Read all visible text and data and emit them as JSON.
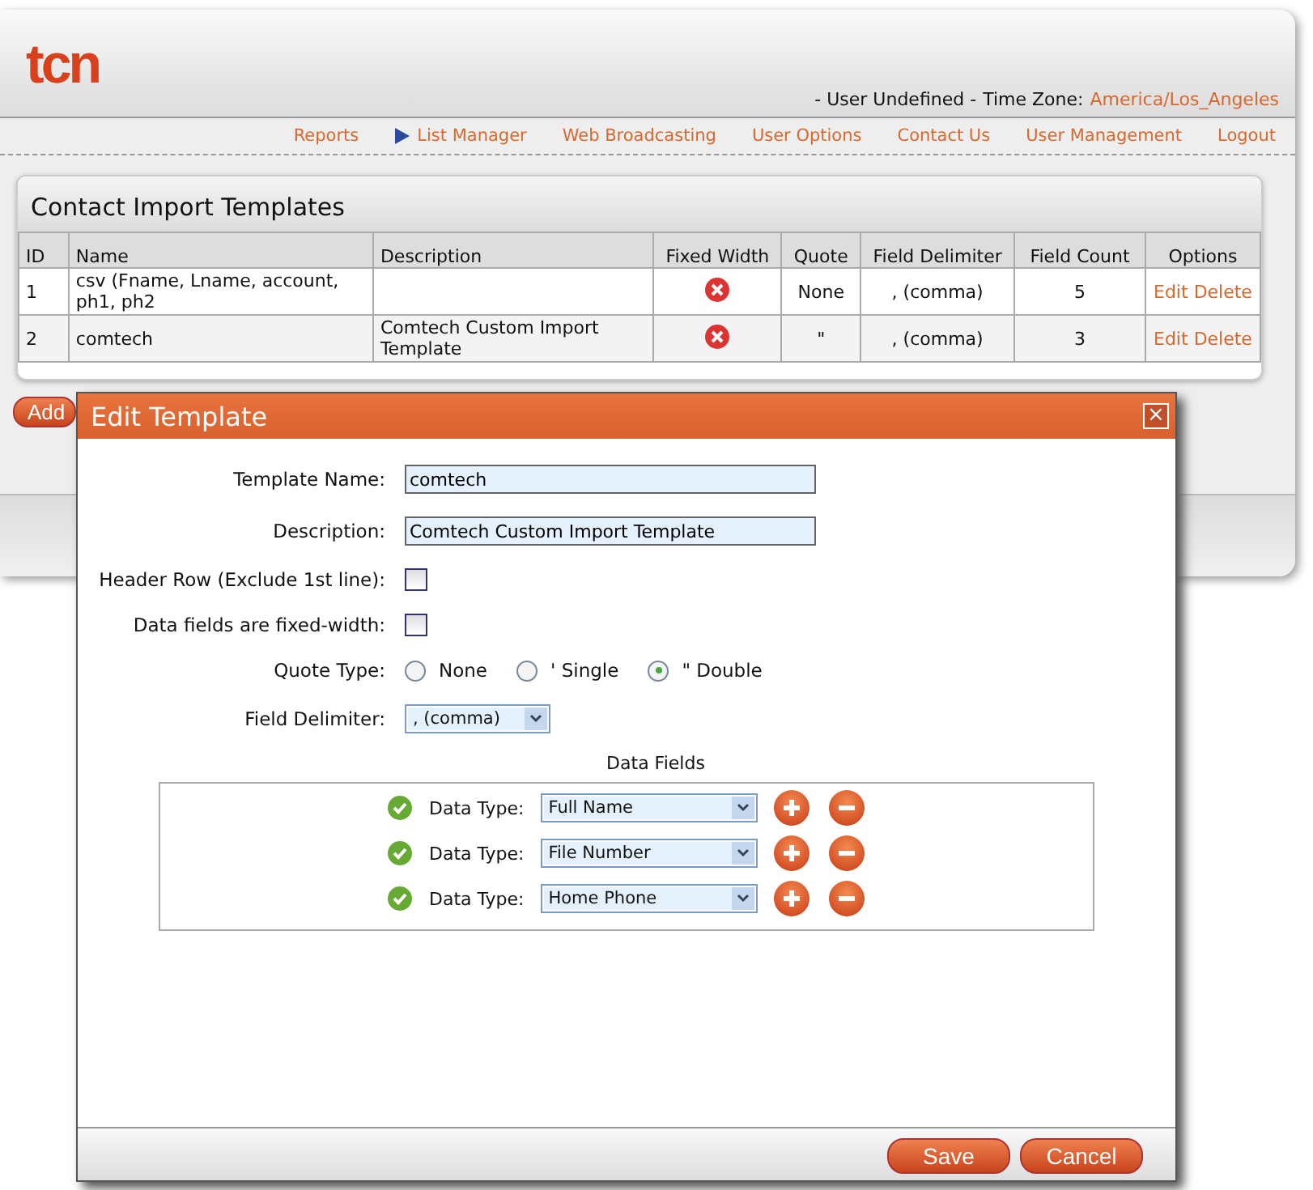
{
  "header": {
    "logo": "tcn",
    "user": "- User Undefined -",
    "timezone_label": "Time Zone:",
    "timezone": "America/Los_Angeles"
  },
  "nav": [
    {
      "label": "Reports",
      "selected": false
    },
    {
      "label": "List Manager",
      "selected": true
    },
    {
      "label": "Web Broadcasting",
      "selected": false
    },
    {
      "label": "User Options",
      "selected": false
    },
    {
      "label": "Contact Us",
      "selected": false
    },
    {
      "label": "User Management",
      "selected": false
    },
    {
      "label": "Logout",
      "selected": false
    }
  ],
  "panel": {
    "title": "Contact Import Templates",
    "columns": [
      "ID",
      "Name",
      "Description",
      "Fixed Width",
      "Quote",
      "Field Delimiter",
      "Field Count",
      "Options"
    ],
    "rows": [
      {
        "id": "1",
        "name": "csv (Fname, Lname, account, ph1, ph2",
        "description": "",
        "fixed_width": false,
        "quote": "None",
        "delimiter": ", (comma)",
        "count": "5",
        "edit": "Edit",
        "delete": "Delete"
      },
      {
        "id": "2",
        "name": "comtech",
        "description": "Comtech Custom Import Template",
        "fixed_width": false,
        "quote": "\"",
        "delimiter": ", (comma)",
        "count": "3",
        "edit": "Edit",
        "delete": "Delete"
      }
    ]
  },
  "add_button": "Add",
  "dialog": {
    "title": "Edit Template",
    "close": "×",
    "template_name": {
      "label": "Template Name:",
      "value": "comtech"
    },
    "description": {
      "label": "Description:",
      "value": "Comtech Custom Import Template"
    },
    "header_row": {
      "label": "Header Row (Exclude 1st line):",
      "checked": false
    },
    "fixed_width": {
      "label": "Data fields are fixed-width:",
      "checked": false
    },
    "quote_type": {
      "label": "Quote Type:",
      "options": [
        {
          "label": "None",
          "selected": false
        },
        {
          "label": "' Single",
          "selected": false
        },
        {
          "label": "\" Double",
          "selected": true
        }
      ]
    },
    "field_delimiter": {
      "label": "Field Delimiter:",
      "value": ", (comma)"
    },
    "data_fields_title": "Data Fields",
    "data_fields": [
      {
        "label": "Data Type:",
        "value": "Full Name"
      },
      {
        "label": "Data Type:",
        "value": "File Number"
      },
      {
        "label": "Data Type:",
        "value": "Home Phone"
      }
    ],
    "buttons": [
      "Save",
      "Cancel"
    ]
  }
}
